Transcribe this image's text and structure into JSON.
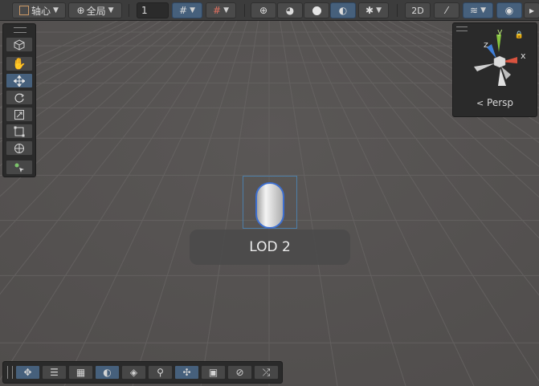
{
  "toolbar": {
    "pivot_label": "轴心",
    "space_label": "全局",
    "grid_size_value": "1"
  },
  "gizmo": {
    "axis_y": "y",
    "axis_x": "x",
    "axis_z": "z",
    "projection_label": "Persp"
  },
  "scene": {
    "lod_label": "LOD 2"
  },
  "colors": {
    "accent_active": "#46607c",
    "axis_x": "#d9533f",
    "axis_y": "#86c43f",
    "axis_z": "#3f7fd8",
    "selection_outline": "#3d6fd0"
  },
  "icons": {
    "tool_panel": [
      "hand-icon",
      "move-icon",
      "rotate-icon",
      "scale-icon",
      "rect-icon",
      "transform-icon",
      "custom-tool-icon"
    ],
    "bottom_overlay": [
      "move-icon",
      "sliders-icon",
      "grid-snap-icon",
      "shading-icon",
      "layers-icon",
      "search-icon",
      "pivot-icon",
      "camera-icon",
      "compass-icon",
      "shuffle-icon"
    ]
  }
}
